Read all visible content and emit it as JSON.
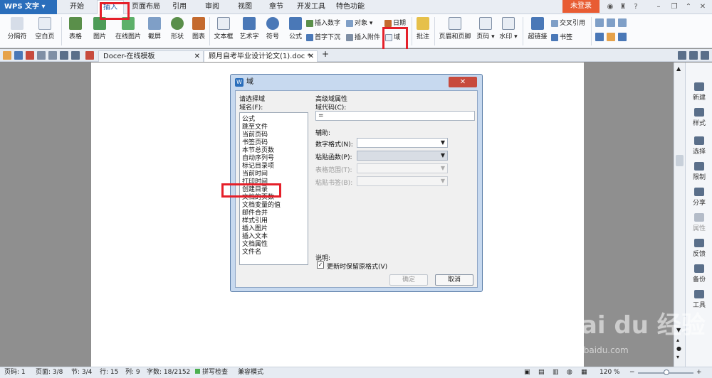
{
  "app": {
    "title": "WPS 文字"
  },
  "menu": {
    "tabs": [
      {
        "label": "开始"
      },
      {
        "label": "插入"
      },
      {
        "label": "页面布局"
      },
      {
        "label": "引用"
      },
      {
        "label": "审阅"
      },
      {
        "label": "视图"
      },
      {
        "label": "章节"
      },
      {
        "label": "开发工具"
      },
      {
        "label": "特色功能"
      }
    ],
    "active": "插入",
    "login_label": "未登录",
    "help_label": "?"
  },
  "ribbon": {
    "page_break": "分隔符",
    "blank_page": "空白页",
    "table": "表格",
    "picture": "图片",
    "online_picture": "在线图片",
    "screenshot": "截屏",
    "shapes": "形状",
    "chart_icon_label": "图表",
    "textbox": "文本框",
    "wordart": "艺术字",
    "symbol": "符号",
    "formula": "公式",
    "insert_number": "插入数字",
    "object": "对象",
    "date": "日期",
    "dropcap": "首字下沉",
    "attachment": "插入附件",
    "field": "域",
    "comment": "批注",
    "header_footer": "页眉和页脚",
    "page_number": "页码",
    "watermark": "水印",
    "hyperlink": "超链接",
    "cross_ref": "交叉引用",
    "bookmark": "书签"
  },
  "tabs": {
    "docer": "Docer-在线模板",
    "doc": "顾月自考毕业设计论文(1).doc *",
    "add": "+"
  },
  "side_panel": {
    "items": [
      {
        "label": "新建"
      },
      {
        "label": "样式"
      },
      {
        "label": "选择"
      },
      {
        "label": "限制"
      },
      {
        "label": "分享"
      },
      {
        "label": "属性"
      },
      {
        "label": "反馈"
      },
      {
        "label": "备份"
      },
      {
        "label": "工具"
      }
    ]
  },
  "status": {
    "page_code": "页码: 1",
    "pages": "页面: 3/8",
    "section": "节: 3/4",
    "row": "行: 15",
    "col": "列: 9",
    "words": "字数: 18/2152",
    "spellcheck": "拼写检查",
    "compat": "兼容模式",
    "zoom": "120 %"
  },
  "dialog": {
    "title": "域",
    "choose_field_group": "请选择域",
    "field_name_label": "域名(F):",
    "field_names": [
      "公式",
      "跳至文件",
      "当前页码",
      "书签页码",
      "本节总页数",
      "自动序列号",
      "标记目录项",
      "当前时间",
      "打印时间",
      "创建目录",
      "文档的页数",
      "文档变量的值",
      "邮件合并",
      "样式引用",
      "插入图片",
      "插入文本",
      "文档属性",
      "文件名"
    ],
    "adv_group": "高级域属性",
    "field_code_label": "域代码(C):",
    "field_code_value": "=",
    "assist_label": "辅助:",
    "number_format_label": "数字格式(N):",
    "paste_func_label": "粘贴函数(P):",
    "table_range_label": "表格范围(T):",
    "paste_bookmark_label": "粘贴书签(B):",
    "note_label": "说明:",
    "keep_format_label": "更新时保留原格式(V)",
    "keep_format_checked": true,
    "ok": "确定",
    "cancel": "取消"
  },
  "watermark": {
    "logo": "Bai du 经验",
    "url": "jingyan.baidu.com"
  }
}
